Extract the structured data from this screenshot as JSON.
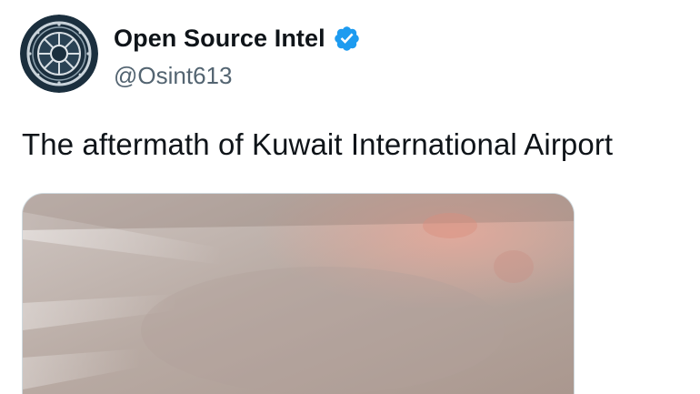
{
  "author": {
    "display_name": "Open Source Intel",
    "handle": "@Osint613",
    "verified": true,
    "avatar_icon": "osint-emblem-avatar",
    "verified_color": "#1d9bf0"
  },
  "tweet": {
    "text": "The aftermath of Kuwait International Airport"
  },
  "media": {
    "type": "photo",
    "icon": "smoke-filled-terminal-photo"
  },
  "colors": {
    "text_primary": "#0f1419",
    "text_secondary": "#536471",
    "avatar_bg": "#1b2f3e"
  }
}
